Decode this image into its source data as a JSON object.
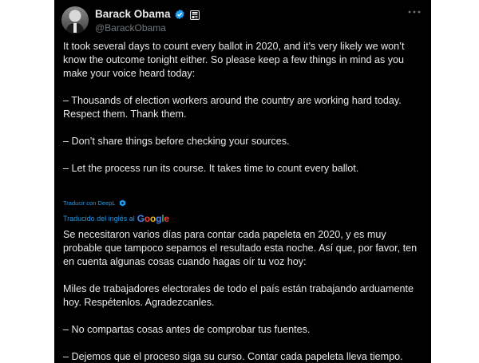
{
  "author": {
    "name": "Barack Obama",
    "handle": "@BarackObama",
    "verified_icon": "verified-badge-icon",
    "affiliation_icon": "official-account-icon"
  },
  "tweet": {
    "original": [
      "It took several days to count every ballot in 2020, and it’s very likely we won’t know the outcome tonight either. So please keep a few things in mind as you make your voice heard today:",
      "– Thousands of election workers around the country are working hard today. Respect them. Thank them.",
      "– Don’t share things before checking your sources.",
      "– Let the process run its course. It takes time to count every ballot."
    ],
    "deepl_link": "Traducir con DeepL",
    "translated_by": "Traducido del inglés al",
    "translator_brand": "Google",
    "translation": [
      "Se necesitaron varios días para contar cada papeleta en 2020, y es muy probable que tampoco sepamos el resultado esta noche. Así que, por favor, ten en cuenta algunas cosas cuando hagas oír tu voz hoy:",
      "Miles de trabajadores electorales de todo el país están trabajando arduamente hoy. Respétenlos. Agradezcanles.",
      "– No compartas cosas antes de comprobar tus fuentes.",
      "– Dejemos que el proceso siga su curso. Contar cada papeleta lleva tiempo."
    ]
  },
  "colors": {
    "background": "#000000",
    "text": "#e7e9ea",
    "secondary": "#71767b",
    "accent": "#1d9bf0"
  }
}
